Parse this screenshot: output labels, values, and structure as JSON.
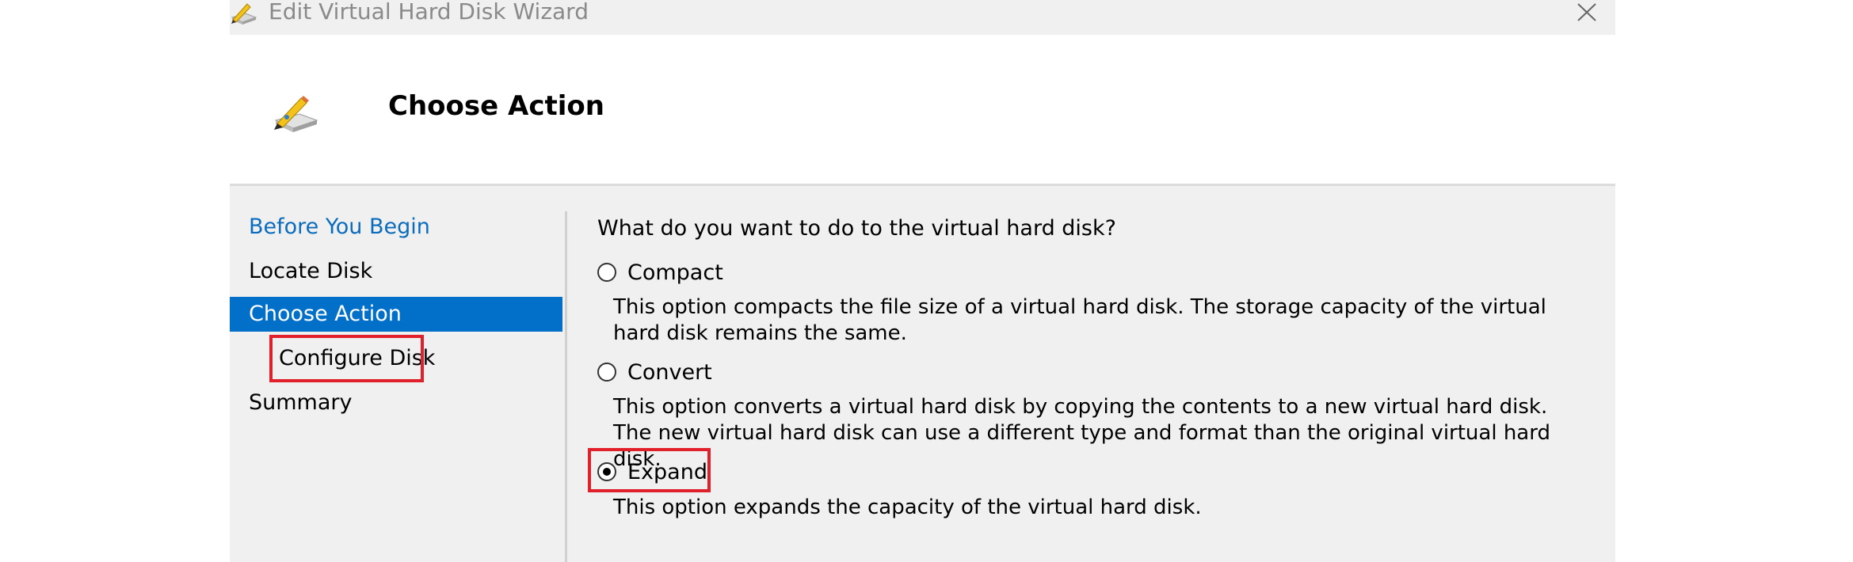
{
  "window": {
    "title": "Edit Virtual Hard Disk Wizard",
    "icon": "wizard-disk-pencil-icon",
    "close_icon": "close-icon"
  },
  "header": {
    "title": "Choose Action",
    "icon": "wizard-disk-pencil-icon"
  },
  "nav": {
    "items": [
      {
        "label": "Before You Begin",
        "state": "link"
      },
      {
        "label": "Locate Disk",
        "state": "normal"
      },
      {
        "label": "Choose Action",
        "state": "selected"
      },
      {
        "label": "Configure Disk",
        "state": "normal",
        "highlighted": true
      },
      {
        "label": "Summary",
        "state": "normal"
      }
    ]
  },
  "content": {
    "question": "What do you want to do to the virtual hard disk?",
    "options": [
      {
        "label": "Compact",
        "selected": false,
        "description": "This option compacts the file size of a virtual hard disk. The storage capacity of the virtual hard disk remains the same."
      },
      {
        "label": "Convert",
        "selected": false,
        "description": "This option converts a virtual hard disk by copying the contents to a new virtual hard disk. The new virtual hard disk can use a different type and format than the original virtual hard disk."
      },
      {
        "label": "Expand",
        "selected": true,
        "highlighted": true,
        "description": "This option expands the capacity of the virtual hard disk."
      }
    ]
  },
  "colors": {
    "nav_selected_bg": "#0270c9",
    "nav_link": "#0b6cbd",
    "highlight_border": "#e0202a",
    "body_bg": "#f0f0f0"
  }
}
